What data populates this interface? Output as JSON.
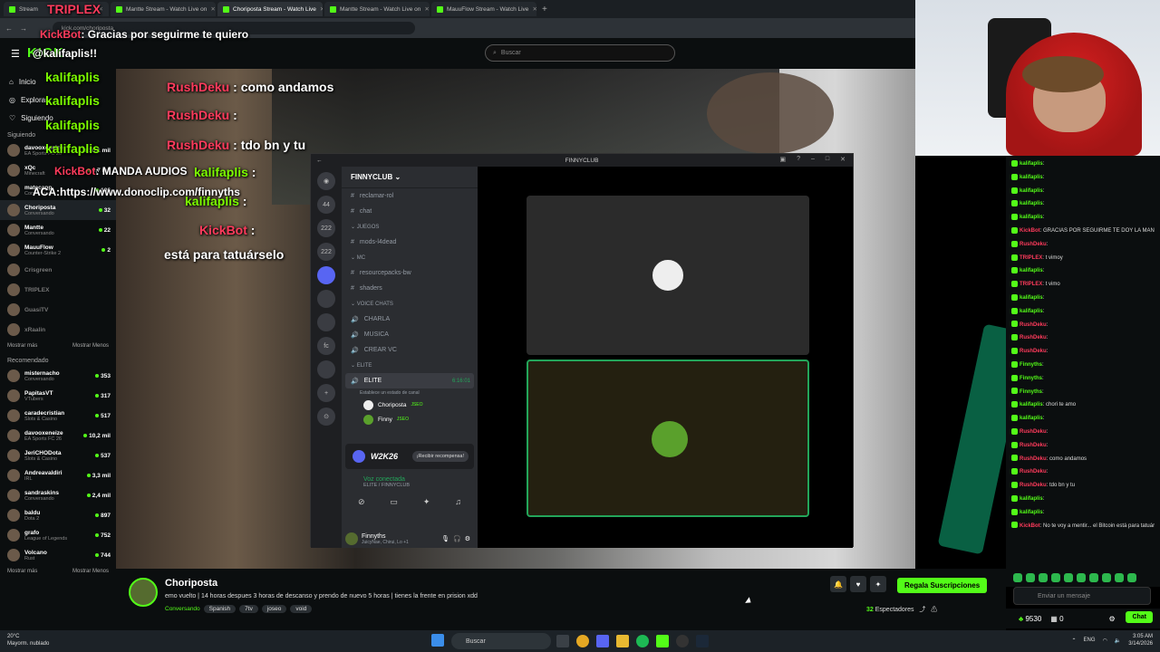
{
  "browser": {
    "tabs": [
      {
        "label": "Stream"
      },
      {
        "label": "Mantte Stream - Watch Live on"
      },
      {
        "label": "Choriposta Stream - Watch Live"
      },
      {
        "label": "Mantte Stream - Watch Live on"
      },
      {
        "label": "MauuFlow Stream - Watch Live"
      }
    ],
    "url": "kick.com/choriposta"
  },
  "kick": {
    "logo": "KICK",
    "search_placeholder": "Buscar",
    "nav": [
      {
        "label": "Inicio"
      },
      {
        "label": "Explorar"
      },
      {
        "label": "Siguiendo"
      }
    ],
    "following_header": "Siguiendo",
    "following": [
      {
        "name": "davooxeneize",
        "category": "EA Sports FC 26",
        "viewers": "10,1 mil",
        "live": true
      },
      {
        "name": "xQc",
        "category": "Minecraft",
        "viewers": "6,7 mil",
        "live": true
      },
      {
        "name": "matecapp",
        "category": "Conversando",
        "viewers": "106",
        "live": true
      },
      {
        "name": "Choriposta",
        "category": "Conversando",
        "viewers": "32",
        "live": true
      },
      {
        "name": "Mantte",
        "category": "Conversando",
        "viewers": "22",
        "live": true
      },
      {
        "name": "MauuFlow",
        "category": "Counter-Strike 2",
        "viewers": "2",
        "live": true
      },
      {
        "name": "Crisgreen",
        "category": "",
        "viewers": "",
        "live": false
      },
      {
        "name": "TRIPLEX",
        "category": "",
        "viewers": "",
        "live": false
      },
      {
        "name": "GuasiTV",
        "category": "",
        "viewers": "",
        "live": false
      },
      {
        "name": "xRaalin",
        "category": "",
        "viewers": "",
        "live": false
      }
    ],
    "show_more": "Mostrar más",
    "show_less": "Mostrar Menos",
    "recommended_header": "Recomendado",
    "recommended": [
      {
        "name": "misternacho",
        "category": "Conversando",
        "viewers": "353"
      },
      {
        "name": "PapitasVT",
        "category": "VTubers",
        "viewers": "317"
      },
      {
        "name": "caradecristian",
        "category": "Slots & Casino",
        "viewers": "517"
      },
      {
        "name": "davooxeneize",
        "category": "EA Sports FC 26",
        "viewers": "10,2 mil"
      },
      {
        "name": "JeriCHODota",
        "category": "Slots & Casino",
        "viewers": "537"
      },
      {
        "name": "Andreavaldiri",
        "category": "IRL",
        "viewers": "3,3 mil"
      },
      {
        "name": "sandraskins",
        "category": "Conversando",
        "viewers": "2,4 mil"
      },
      {
        "name": "baldu",
        "category": "Dota 2",
        "viewers": "897"
      },
      {
        "name": "grafo",
        "category": "League of Legends",
        "viewers": "752"
      },
      {
        "name": "Volcano",
        "category": "Rust",
        "viewers": "744"
      }
    ]
  },
  "overlay_chat": [
    {
      "user": "TRIPLEX",
      "text": ""
    },
    {
      "user": "KickBot",
      "text": "Gracias por seguirme te quiero"
    },
    {
      "user": "",
      "text": "@kalifaplis!!"
    },
    {
      "user": "kalifaplis",
      "text": ""
    },
    {
      "user": "kalifaplis",
      "text": ""
    },
    {
      "user": "kalifaplis",
      "text": ""
    },
    {
      "user": "kalifaplis",
      "text": ""
    },
    {
      "user": "KickBot",
      "text": "MANDA AUDIOS"
    },
    {
      "user": "",
      "text": "ACA:https://www.donoclip.com/finnyths"
    },
    {
      "user": "RushDeku",
      "text": "como andamos"
    },
    {
      "user": "RushDeku",
      "text": ""
    },
    {
      "user": "RushDeku",
      "text": "tdo bn y tu"
    },
    {
      "user": "kalifaplis",
      "text": ""
    },
    {
      "user": "kalifaplis",
      "text": ""
    },
    {
      "user": "KickBot",
      "text": "No te voy a mentir..."
    },
    {
      "user": "",
      "text": "está para tatuárselo"
    }
  ],
  "stream": {
    "title": "Choriposta",
    "description": "emo vuelto | 14 horas despues 3 horas de descanso y prendo de nuevo 5 horas | tienes la frente en prision xdd",
    "category": "Conversando",
    "tags": [
      "Spanish",
      "7tv",
      "joseo",
      "void"
    ],
    "subscribe_label": "Regala Suscripciones",
    "viewers": "32",
    "viewers_label": "Espectadores"
  },
  "discord": {
    "window_title": "FINNYCLUB",
    "server_name": "FINNYCLUB",
    "channels": [
      {
        "type": "text",
        "label": "reclamar-rol"
      },
      {
        "type": "text",
        "label": "chat"
      },
      {
        "type": "category",
        "label": "JUEGOS"
      },
      {
        "type": "text",
        "label": "mods-l4dead"
      },
      {
        "type": "category",
        "label": "MC"
      },
      {
        "type": "text",
        "label": "resourcepacks-bw"
      },
      {
        "type": "text",
        "label": "shaders"
      },
      {
        "type": "category",
        "label": "VOICE CHATS"
      },
      {
        "type": "voice",
        "label": "CHARLA"
      },
      {
        "type": "voice",
        "label": "MUSICA"
      },
      {
        "type": "voice",
        "label": "CREAR VC"
      },
      {
        "type": "category",
        "label": "ELITE"
      }
    ],
    "active_voice": {
      "label": "ELITE",
      "timer": "6:16:01",
      "status": "Establece un estado de canal"
    },
    "voice_users": [
      {
        "name": "Choriposta",
        "tag": "JSEO"
      },
      {
        "name": "Finny",
        "tag": "JSEO"
      }
    ],
    "promo_title": "W2K26",
    "promo_button": "¡Recibir recompensa!",
    "voice_connected": "Voz conectada",
    "voice_server": "ELITE / FINNYCLUB",
    "user_name": "Finnyths",
    "user_status": "JuicyNae, Chirui, Lo +1",
    "server_badges": [
      "44",
      "222",
      "222"
    ]
  },
  "chat": {
    "messages": [
      {
        "user": "kalifaplis",
        "text": "",
        "color": "green"
      },
      {
        "user": "kalifaplis",
        "text": "",
        "color": "green"
      },
      {
        "user": "kalifaplis",
        "text": "",
        "color": "green"
      },
      {
        "user": "kalifaplis",
        "text": "",
        "color": "green"
      },
      {
        "user": "kalifaplis",
        "text": "",
        "color": "green"
      },
      {
        "user": "KickBot",
        "text": "GRACIAS POR SEGUIRME TE DOY LA MANO ERMANO",
        "color": "red"
      },
      {
        "user": "RushDeku",
        "text": "",
        "color": "red"
      },
      {
        "user": "TRIPLEX",
        "text": "t vimoy",
        "color": "red"
      },
      {
        "user": "kalifaplis",
        "text": "",
        "color": "green"
      },
      {
        "user": "TRIPLEX",
        "text": "t vimo",
        "color": "red"
      },
      {
        "user": "kalifaplis",
        "text": "",
        "color": "green"
      },
      {
        "user": "kalifaplis",
        "text": "",
        "color": "green"
      },
      {
        "user": "RushDeku",
        "text": "",
        "color": "red"
      },
      {
        "user": "RushDeku",
        "text": "",
        "color": "red"
      },
      {
        "user": "RushDeku",
        "text": "",
        "color": "red"
      },
      {
        "user": "Finnyths",
        "text": "",
        "color": "green"
      },
      {
        "user": "Finnyths",
        "text": "",
        "color": "green"
      },
      {
        "user": "Finnyths",
        "text": "",
        "color": "green"
      },
      {
        "user": "kalifaplis",
        "text": "chori te amo",
        "color": "green"
      },
      {
        "user": "kalifaplis",
        "text": "",
        "color": "green"
      },
      {
        "user": "RushDeku",
        "text": "",
        "color": "red"
      },
      {
        "user": "RushDeku",
        "text": "",
        "color": "red"
      },
      {
        "user": "RushDeku",
        "text": "como andamos",
        "color": "red"
      },
      {
        "user": "RushDeku",
        "text": "",
        "color": "red"
      },
      {
        "user": "RushDeku",
        "text": "tdo bn y tu",
        "color": "red"
      },
      {
        "user": "kalifaplis",
        "text": "",
        "color": "green"
      },
      {
        "user": "kalifaplis",
        "text": "",
        "color": "green"
      },
      {
        "user": "KickBot",
        "text": "No te voy a mentir... el Bitcoin está para tatuárselo",
        "color": "red"
      }
    ],
    "input_placeholder": "Enviar un mensaje",
    "points": "9530",
    "gifts": "0",
    "chat_button": "Chat"
  },
  "taskbar": {
    "temperature": "20°C",
    "weather": "Mayorm. nublado",
    "search": "Buscar",
    "lang": "ENG",
    "time": "3:05 AM",
    "date": "3/14/2026"
  },
  "colors": {
    "kick_green": "#53fc18",
    "discord_green": "#23a55a"
  }
}
